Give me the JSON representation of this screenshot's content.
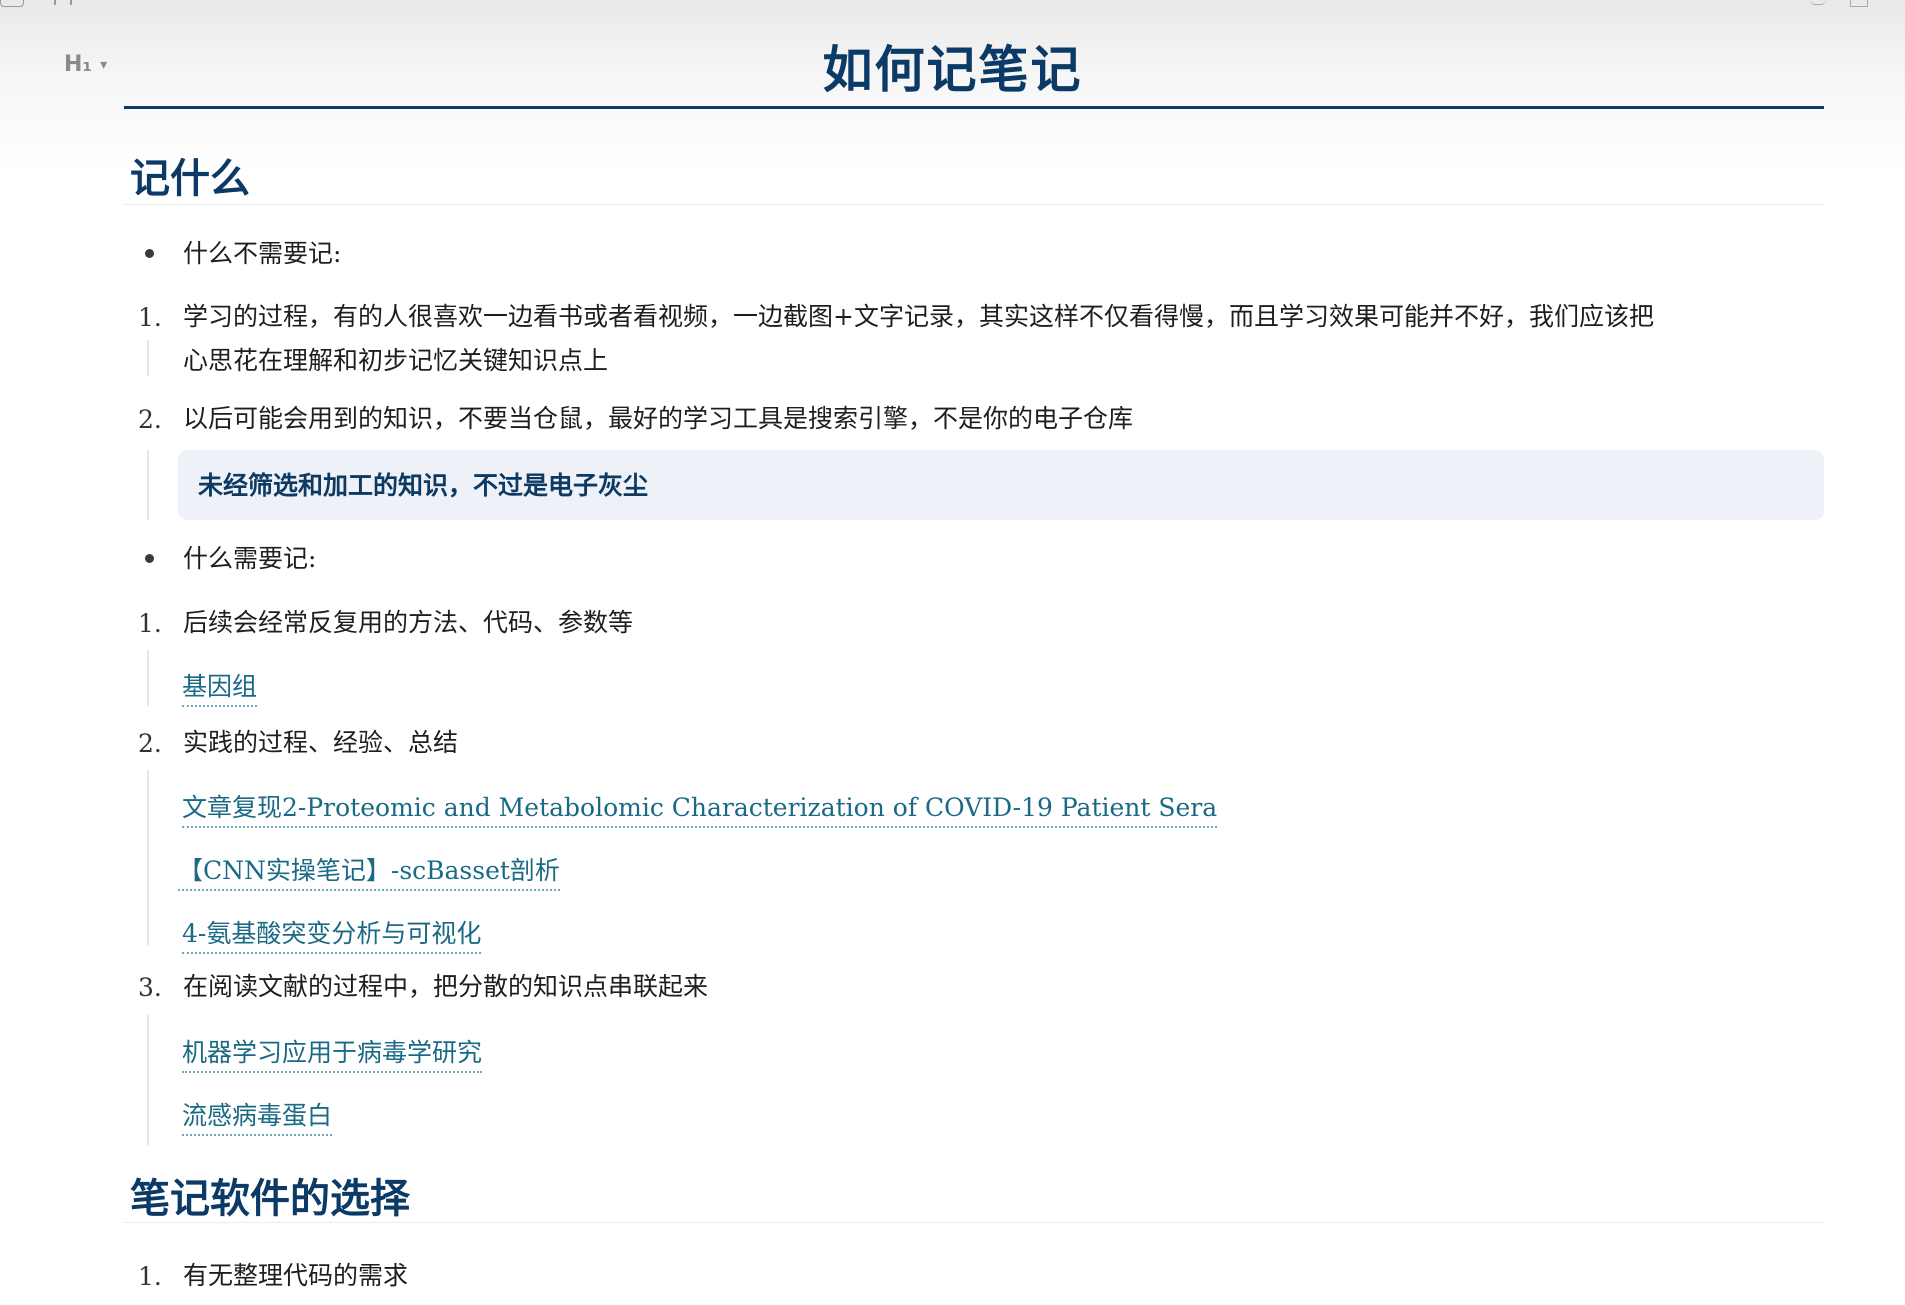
{
  "toolbar": {
    "heading_level": "H₁",
    "chevron": "▾"
  },
  "title": "如何记笔记",
  "sections": [
    {
      "heading": "记什么",
      "blocks": {
        "bullet1": "什么不需要记:",
        "item1_line1": "学习的过程，有的人很喜欢一边看书或者看视频，一边截图+文字记录，其实这样不仅看得慢，而且学习效果可能并不好，我们应该把",
        "item1_line2": "心思花在理解和初步记忆关键知识点上",
        "item2": "以后可能会用到的知识，不要当仓鼠，最好的学习工具是搜索引擎，不是你的电子仓库",
        "callout": "未经筛选和加工的知识，不过是电子灰尘",
        "bullet2": "什么需要记:",
        "item3": "后续会经常反复用的方法、代码、参数等",
        "link1": "基因组",
        "item4": "实践的过程、经验、总结",
        "link2": "文章复现2-Proteomic and Metabolomic Characterization of COVID-19 Patient Sera",
        "link3": "【CNN实操笔记】-scBasset剖析",
        "link4": "4-氨基酸突变分析与可视化",
        "item5": "在阅读文献的过程中，把分散的知识点串联起来",
        "link5": "机器学习应用于病毒学研究",
        "link6": "流感病毒蛋白"
      }
    },
    {
      "heading": "笔记软件的选择",
      "blocks": {
        "item1": "有无整理代码的需求"
      }
    }
  ],
  "numbers": [
    "1.",
    "2.",
    "3."
  ],
  "colors": {
    "heading": "#0b3a66",
    "link": "#1a6a86",
    "callout_bg": "#eef2f8"
  }
}
